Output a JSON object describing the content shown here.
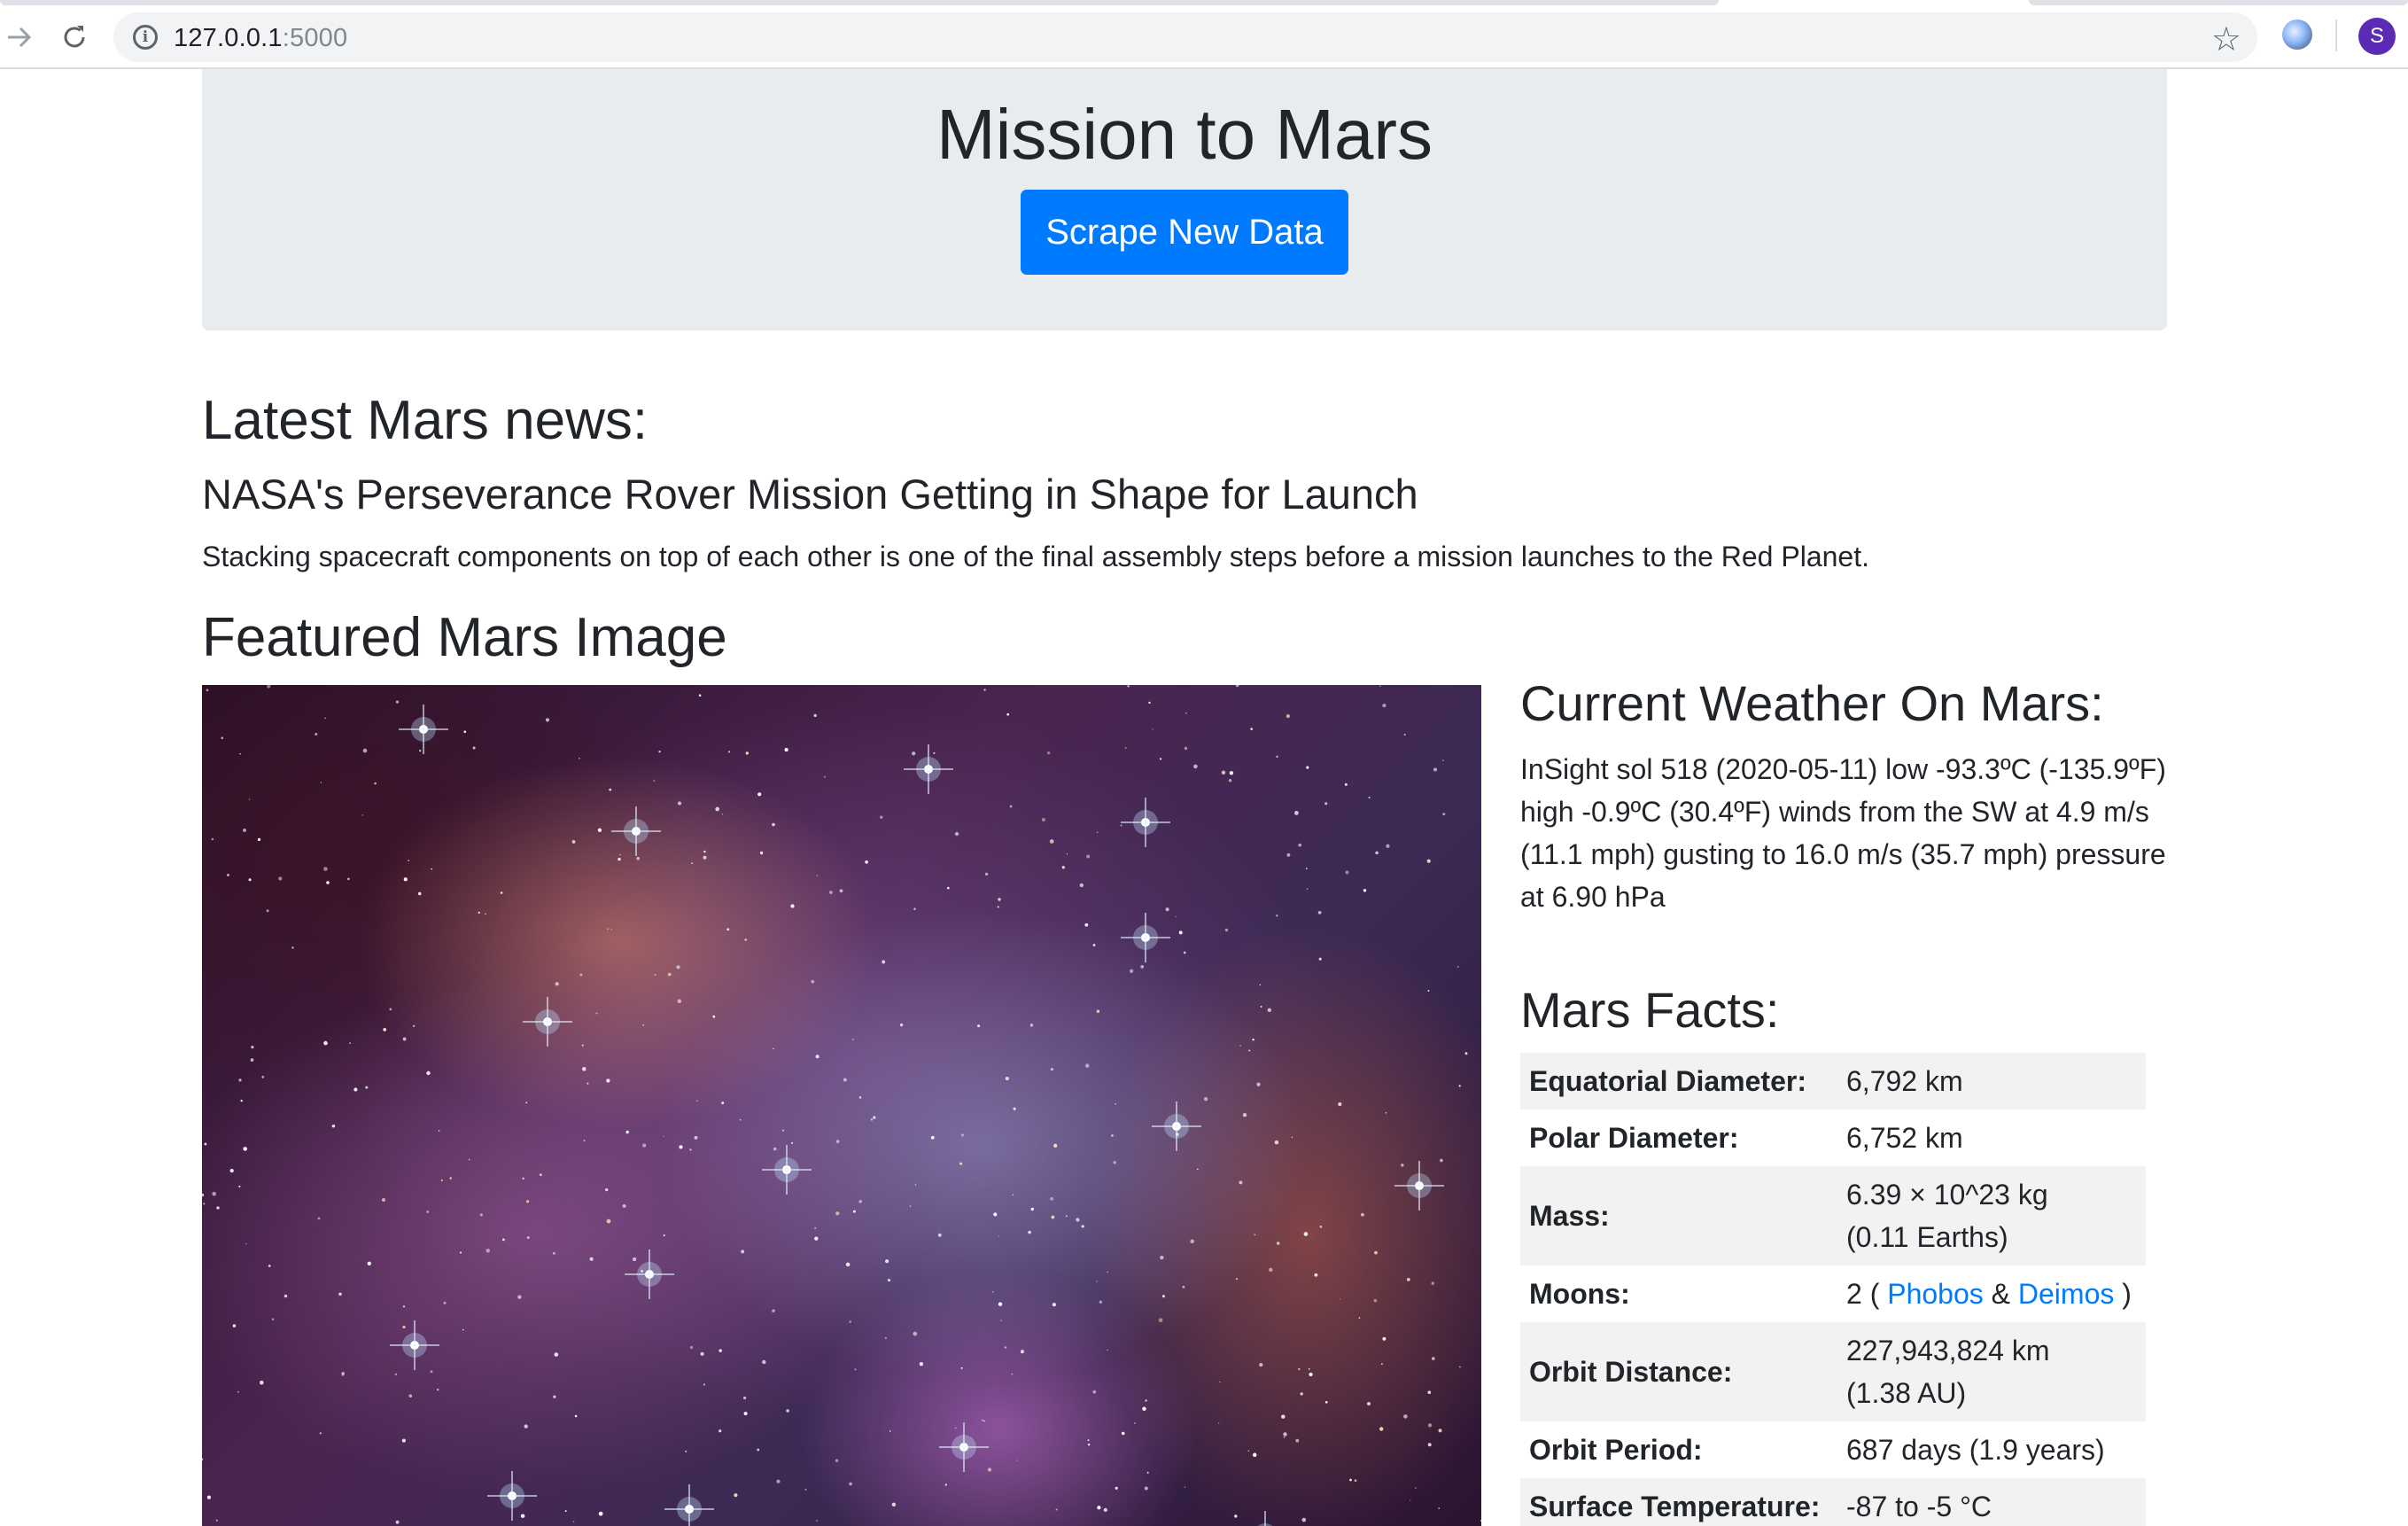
{
  "browser": {
    "url_host": "127.0.0.1",
    "url_port": ":5000",
    "back_icon": "arrow-forward-icon",
    "reload_icon": "reload-icon",
    "info_icon": "info-icon",
    "bookmark_icon": "star-icon",
    "profile_initial": "S",
    "profile_color": "#5b2bb5"
  },
  "jumbotron": {
    "title": "Mission to Mars",
    "button_label": "Scrape New Data",
    "button_color": "#007bff",
    "background": "#e9ecef"
  },
  "news": {
    "heading": "Latest Mars news:",
    "title": "NASA's Perseverance Rover Mission Getting in Shape for Launch",
    "teaser": "Stacking spacecraft components on top of each other is one of the final assembly steps before a mission launches to the Red Planet."
  },
  "featured": {
    "heading": "Featured Mars Image"
  },
  "weather": {
    "heading": "Current Weather On Mars:",
    "text": "InSight sol 518 (2020-05-11) low -93.3ºC (-135.9ºF) high -0.9ºC (30.4ºF) winds from the SW at 4.9 m/s (11.1 mph) gusting to 16.0 m/s (35.7 mph) pressure at 6.90 hPa"
  },
  "facts": {
    "heading": "Mars Facts:",
    "rows": [
      {
        "label": "Equatorial Diameter:",
        "value": "6,792 km"
      },
      {
        "label": "Polar Diameter:",
        "value": "6,752 km"
      },
      {
        "label": "Mass:",
        "value_line1": "6.39 × 10^23 kg",
        "value_line2": "(0.11 Earths)"
      },
      {
        "label": "Moons:",
        "value_prefix": "2 ( ",
        "link1": "Phobos",
        "value_mid": " & ",
        "link2": "Deimos",
        "value_suffix": " )"
      },
      {
        "label": "Orbit Distance:",
        "value_line1": "227,943,824 km",
        "value_line2": "(1.38 AU)"
      },
      {
        "label": "Orbit Period:",
        "value": "687 days (1.9 years)"
      },
      {
        "label": "Surface Temperature:",
        "value": "-87 to -5 °C"
      }
    ],
    "link_color": "#007bff"
  }
}
